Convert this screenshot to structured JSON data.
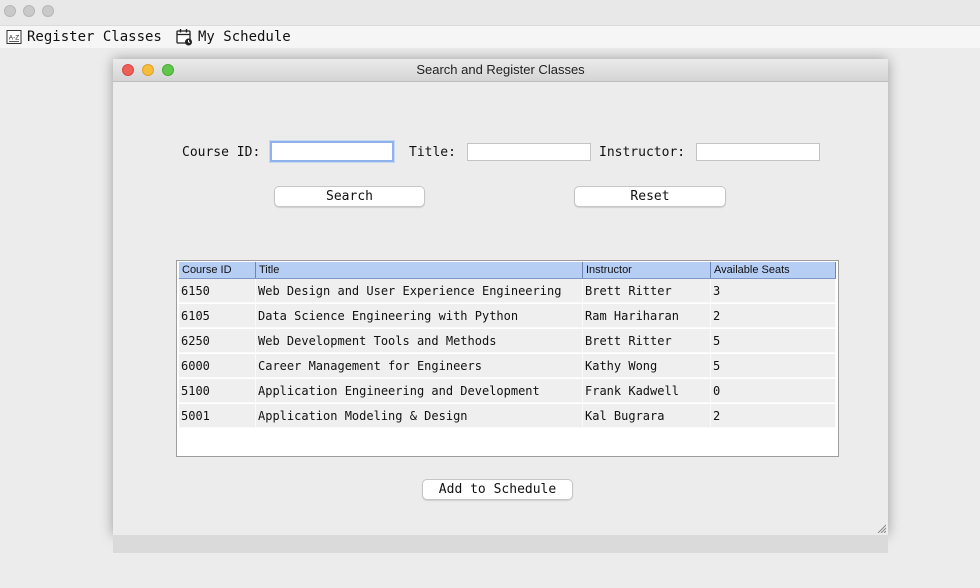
{
  "menubar": {
    "items": [
      {
        "label": "Register Classes",
        "icon": "az-icon"
      },
      {
        "label": "My Schedule",
        "icon": "calendar-icon"
      }
    ]
  },
  "dialog": {
    "title": "Search and Register Classes",
    "form": {
      "course_id_label": "Course ID:",
      "course_id_value": "",
      "title_label": "Title:",
      "title_value": "",
      "instructor_label": "Instructor:",
      "instructor_value": "",
      "search_button": "Search",
      "reset_button": "Reset"
    },
    "table": {
      "columns": [
        "Course ID",
        "Title",
        "Instructor",
        "Available Seats"
      ],
      "rows": [
        [
          "6150",
          "Web Design and User Experience Engineering",
          "Brett Ritter",
          "3"
        ],
        [
          "6105",
          "Data Science Engineering with Python",
          "Ram Hariharan",
          "2"
        ],
        [
          "6250",
          "Web Development Tools and Methods",
          "Brett Ritter",
          "5"
        ],
        [
          "6000",
          "Career Management for Engineers",
          "Kathy Wong",
          "5"
        ],
        [
          "5100",
          "Application Engineering and Development",
          "Frank Kadwell",
          "0"
        ],
        [
          "5001",
          "Application Modeling & Design",
          "Kal Bugrara",
          "2"
        ]
      ]
    },
    "add_button": "Add to Schedule"
  },
  "colors": {
    "header_blue": "#b6cdf4",
    "close": "#ee5f57",
    "minimize": "#f6bd3b",
    "zoom": "#5fc84a"
  }
}
